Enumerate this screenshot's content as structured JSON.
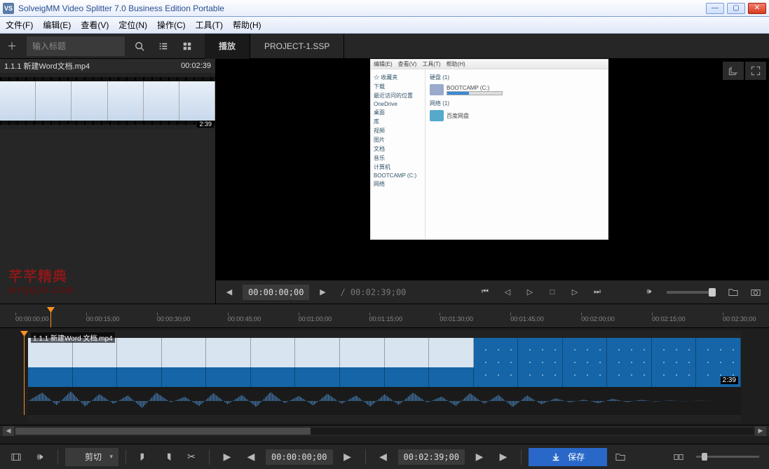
{
  "window": {
    "logo": "VS",
    "title": "SolveigMM Video Splitter 7.0 Business Edition Portable"
  },
  "menu": {
    "file": "文件(F)",
    "edit": "编辑(E)",
    "view": "查看(V)",
    "navigate": "定位(N)",
    "control": "操作(C)",
    "tools": "工具(T)",
    "help": "帮助(H)"
  },
  "toolbar": {
    "search_placeholder": "输入标题",
    "tab_play": "播放",
    "tab_project": "PROJECT-1.SSP"
  },
  "clip": {
    "name": "1.1.1 新建Word文档.mp4",
    "duration": "00:02:39",
    "badge": "2:39"
  },
  "brand": {
    "line1": "芊芊精典",
    "line2": "MYQQJD.COM"
  },
  "preview": {
    "shell_items": [
      "编辑(E)",
      "查看(V)",
      "工具(T)",
      "帮助(H)"
    ],
    "side": [
      "☆ 收藏夹",
      "下载",
      "最近访问的位置",
      "OneDrive",
      "桌面",
      "",
      "库",
      "视频",
      "图片",
      "文档",
      "音乐",
      "",
      "计算机",
      "BOOTCAMP (C:)",
      "",
      "网络"
    ],
    "groups": {
      "disk": "硬盘 (1)",
      "net": "网络 (1)"
    },
    "drive": "BOOTCAMP (C:)",
    "netdrive": "百度网盘"
  },
  "transport": {
    "current": "00:00:00;00",
    "total": "/ 00:02:39;00"
  },
  "ruler": [
    "00:00:00;00",
    "00:00:15;00",
    "00:00:30;00",
    "00:00:45;00",
    "00:01:00;00",
    "00:01:15;00",
    "00:01:30;00",
    "00:01:45;00",
    "00:02:00;00",
    "00:02:15;00",
    "00:02:30;00"
  ],
  "track": {
    "label": "1.1.1 新建Word 文档.mp4",
    "badge": "2:39"
  },
  "bottom": {
    "cut": "剪切",
    "in_tc": "00:00:00;00",
    "out_tc": "00:02:39;00",
    "save": "保存"
  }
}
